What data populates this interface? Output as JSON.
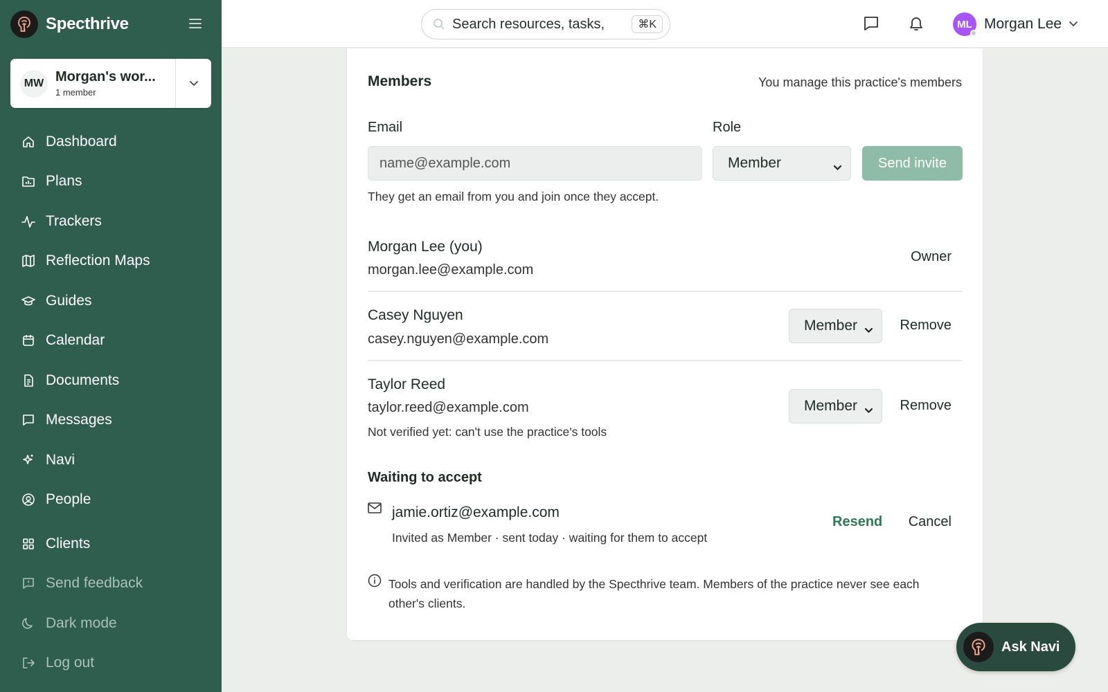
{
  "app": {
    "name": "Specthrive"
  },
  "workspace": {
    "initials": "MW",
    "name": "Morgan's wor...",
    "members": "1 member"
  },
  "nav": {
    "items": [
      {
        "label": "Dashboard",
        "icon": "home-icon"
      },
      {
        "label": "Plans",
        "icon": "folder-chart-icon"
      },
      {
        "label": "Trackers",
        "icon": "activity-icon"
      },
      {
        "label": "Reflection Maps",
        "icon": "map-icon"
      },
      {
        "label": "Guides",
        "icon": "graduation-cap-icon"
      },
      {
        "label": "Calendar",
        "icon": "calendar-icon"
      },
      {
        "label": "Documents",
        "icon": "document-icon"
      },
      {
        "label": "Messages",
        "icon": "message-icon"
      },
      {
        "label": "Navi",
        "icon": "sparkles-icon"
      },
      {
        "label": "People",
        "icon": "user-circle-icon"
      },
      {
        "label": "Clients",
        "icon": "grid-icon"
      }
    ],
    "secondary": [
      {
        "label": "Send feedback",
        "icon": "feedback-icon"
      },
      {
        "label": "Dark mode",
        "icon": "moon-icon"
      },
      {
        "label": "Log out",
        "icon": "logout-icon"
      }
    ]
  },
  "topbar": {
    "search_text": "Search resources, tasks,",
    "shortcut": "⌘K",
    "user": {
      "initials": "ML",
      "name": "Morgan Lee"
    }
  },
  "members": {
    "title": "Members",
    "manage_note": "You manage this practice's members",
    "invite": {
      "email_label": "Email",
      "email_placeholder": "name@example.com",
      "role_label": "Role",
      "role_value": "Member",
      "send_label": "Send invite",
      "hint": "They get an email from you and join once they accept."
    },
    "list": [
      {
        "name": "Morgan Lee (you)",
        "email": "morgan.lee@example.com",
        "role": "Owner"
      },
      {
        "name": "Casey Nguyen",
        "email": "casey.nguyen@example.com",
        "role": "Member",
        "action": "Remove"
      },
      {
        "name": "Taylor Reed",
        "email": "taylor.reed@example.com",
        "role": "Member",
        "action": "Remove",
        "note": "Not verified yet: can't use the practice's tools"
      }
    ],
    "waiting": {
      "title": "Waiting to accept",
      "email": "jamie.ortiz@example.com",
      "meta": "Invited as Member · sent today · waiting for them to accept",
      "resend": "Resend",
      "cancel": "Cancel"
    },
    "info": "Tools and verification are handled by the Specthrive team. Members of the practice never see each other's clients."
  },
  "ask_navi": {
    "label": "Ask Navi"
  },
  "colors": {
    "sidebar": "#2f5e4f",
    "accent": "#2f7a55",
    "send_button": "#8fbba9",
    "avatar": "#a855f7"
  }
}
